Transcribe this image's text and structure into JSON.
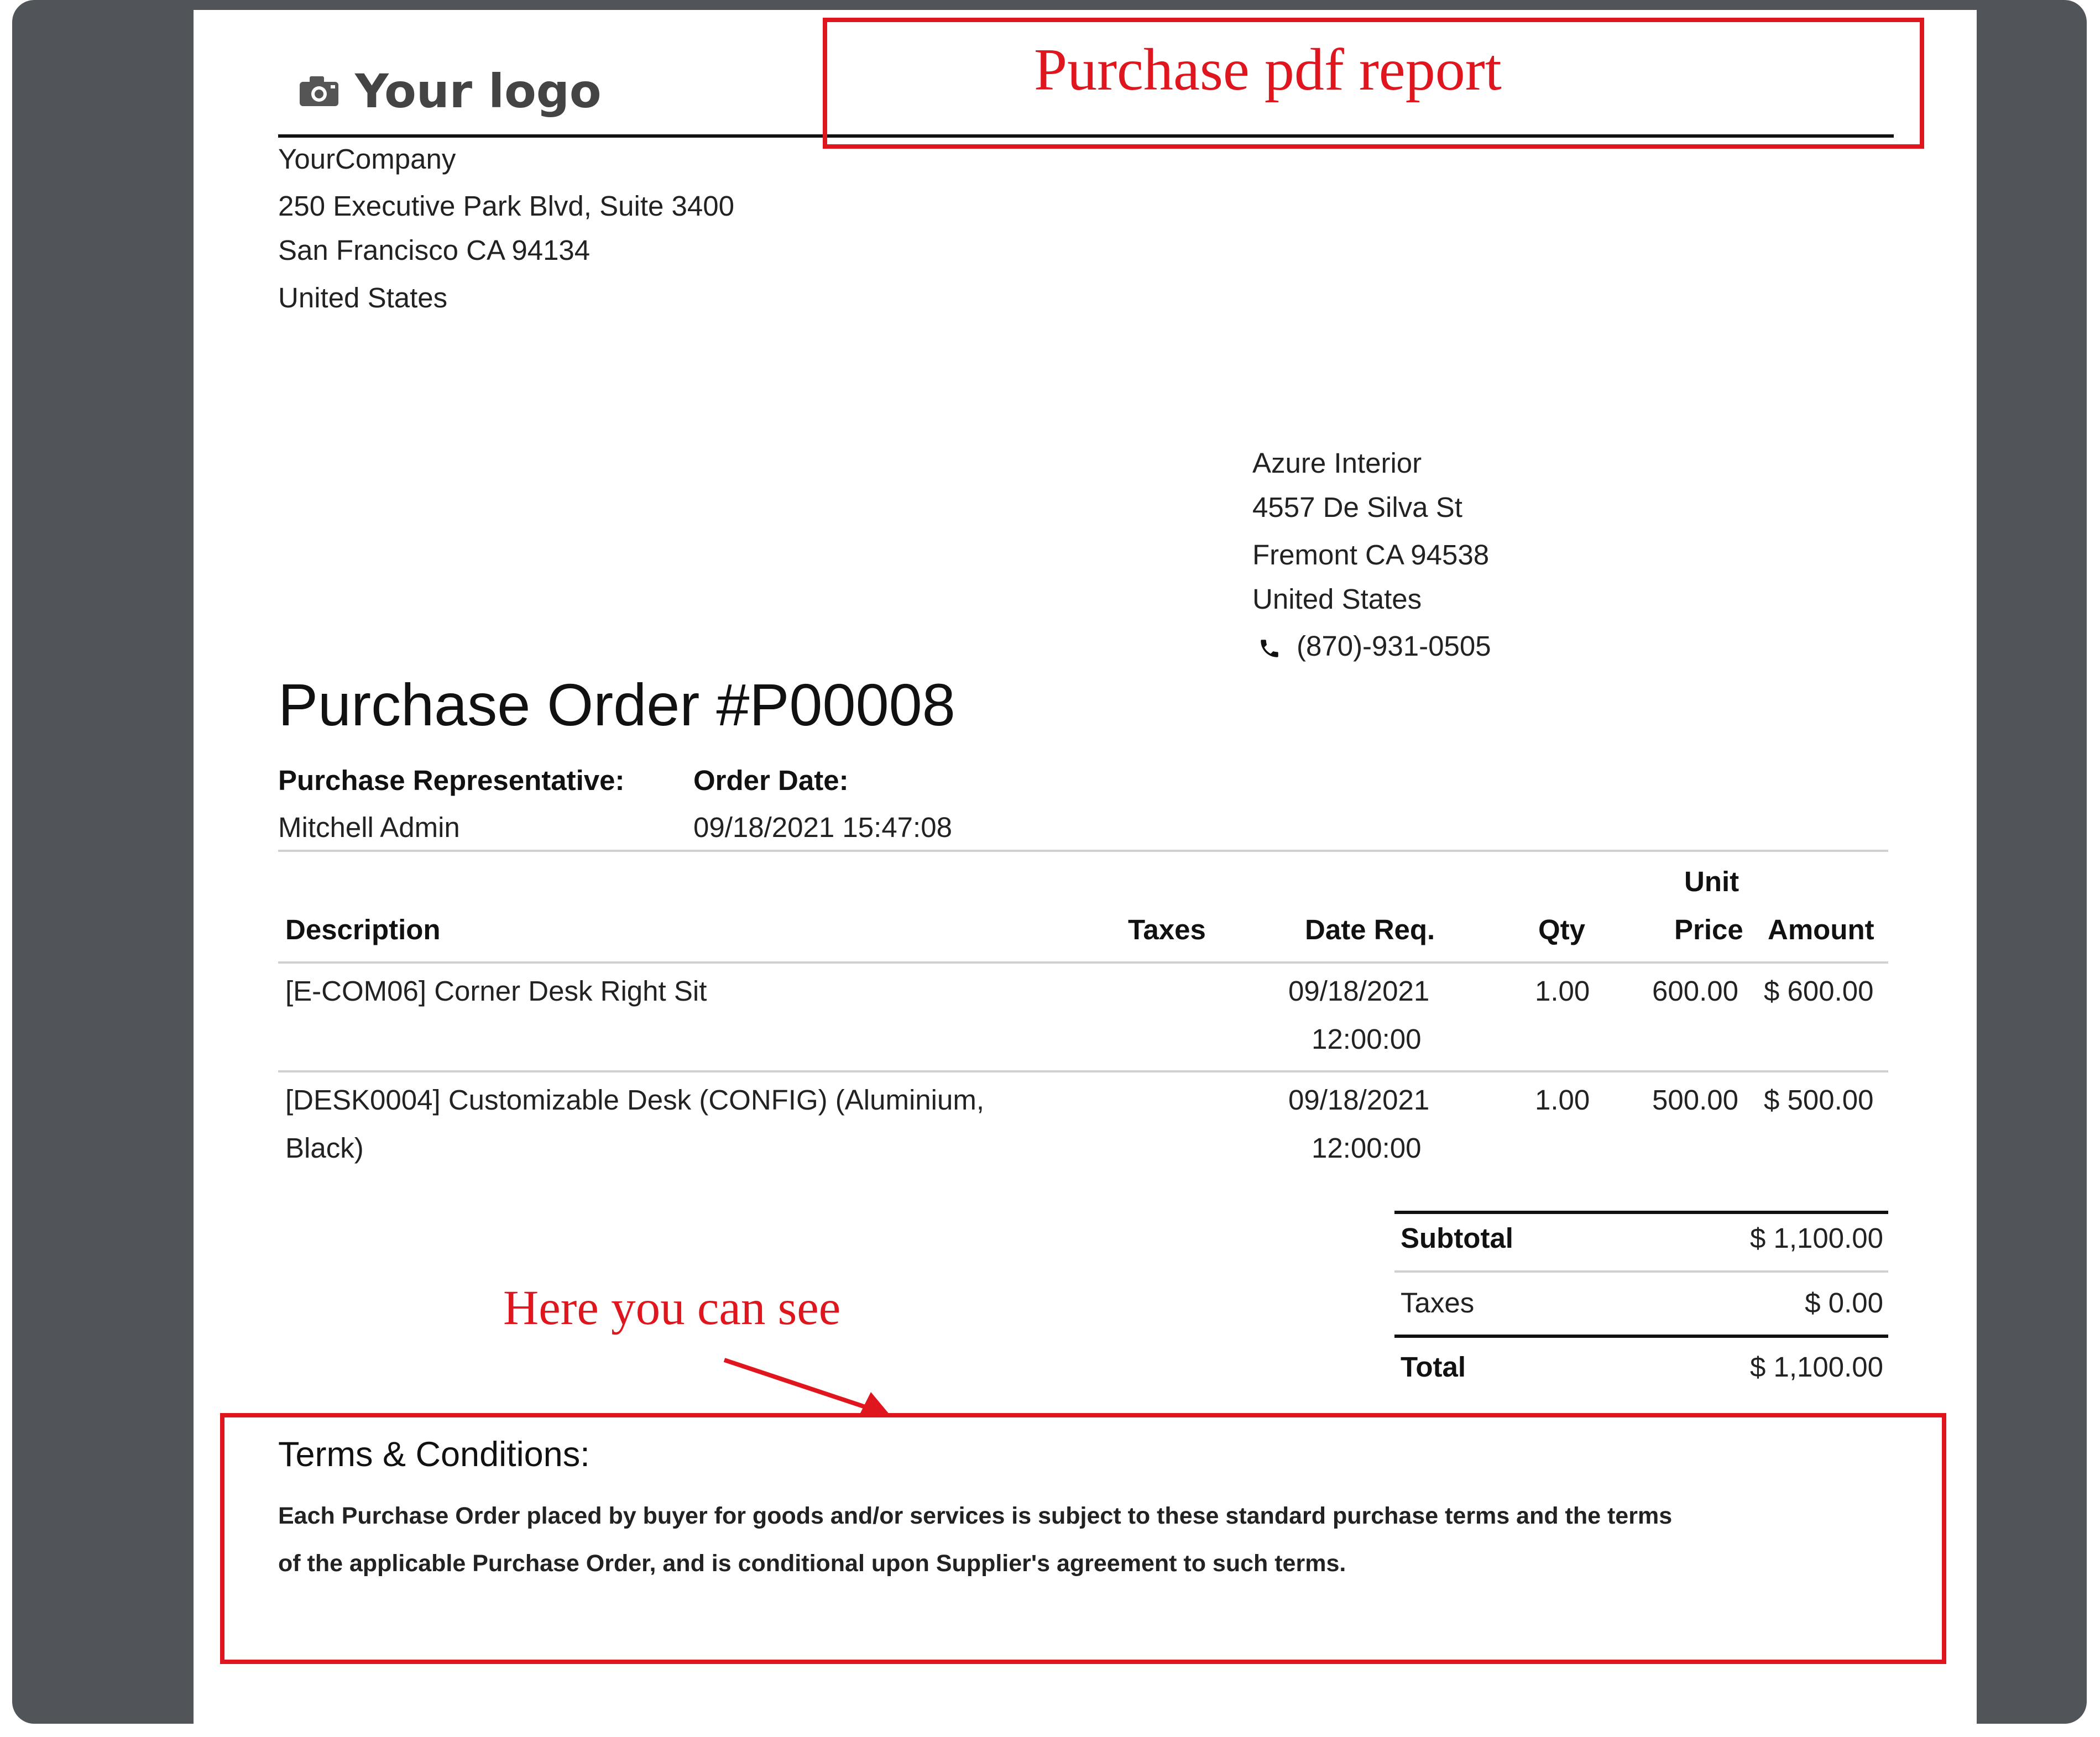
{
  "annotations": {
    "top_label": "Purchase pdf report",
    "bottom_label": "Here you can see"
  },
  "logo": {
    "text": "Your logo",
    "icon": "camera-icon"
  },
  "company": {
    "name": "YourCompany",
    "street": "250 Executive Park Blvd, Suite 3400",
    "city_line": "San Francisco CA 94134",
    "country": "United States"
  },
  "vendor": {
    "name": "Azure Interior",
    "street": "4557 De Silva St",
    "city_line": "Fremont CA 94538",
    "country": "United States",
    "phone": "(870)-931-0505"
  },
  "order": {
    "title": "Purchase Order #P00008",
    "rep_label": "Purchase Representative:",
    "rep_value": "Mitchell Admin",
    "date_label": "Order Date:",
    "date_value": "09/18/2021 15:47:08"
  },
  "table": {
    "headers": {
      "description": "Description",
      "taxes": "Taxes",
      "date_req": "Date Req.",
      "qty": "Qty",
      "unit_price_1": "Unit",
      "unit_price_2": "Price",
      "amount": "Amount"
    },
    "rows": [
      {
        "description_1": "[E-COM06] Corner Desk Right Sit",
        "description_2": "",
        "taxes": "",
        "date_1": "09/18/2021",
        "date_2": "12:00:00",
        "qty": "1.00",
        "unit_price": "600.00",
        "amount": "$ 600.00"
      },
      {
        "description_1": "[DESK0004] Customizable Desk (CONFIG) (Aluminium,",
        "description_2": "Black)",
        "taxes": "",
        "date_1": "09/18/2021",
        "date_2": "12:00:00",
        "qty": "1.00",
        "unit_price": "500.00",
        "amount": "$ 500.00"
      }
    ]
  },
  "totals": {
    "subtotal_label": "Subtotal",
    "subtotal_value": "$ 1,100.00",
    "taxes_label": "Taxes",
    "taxes_value": "$ 0.00",
    "total_label": "Total",
    "total_value": "$ 1,100.00"
  },
  "terms": {
    "title": "Terms & Conditions:",
    "line_1": "Each Purchase Order placed by buyer for goods and/or services is subject to these standard purchase terms and the terms",
    "line_2": "of the applicable Purchase Order, and is conditional upon Supplier's agreement to such terms."
  }
}
